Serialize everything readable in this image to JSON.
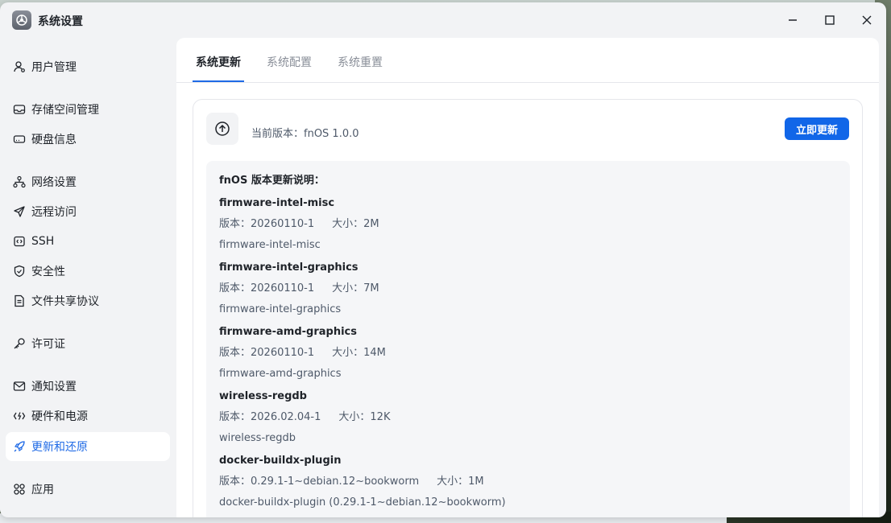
{
  "window": {
    "title": "系统设置"
  },
  "sidebar": {
    "items": [
      {
        "label": "用户管理",
        "icon": "user-icon"
      },
      {
        "label": "存储空间管理",
        "icon": "storage-icon"
      },
      {
        "label": "硬盘信息",
        "icon": "disk-icon"
      },
      {
        "label": "网络设置",
        "icon": "network-icon"
      },
      {
        "label": "远程访问",
        "icon": "send-icon"
      },
      {
        "label": "SSH",
        "icon": "code-icon"
      },
      {
        "label": "安全性",
        "icon": "shield-icon"
      },
      {
        "label": "文件共享协议",
        "icon": "file-icon"
      },
      {
        "label": "许可证",
        "icon": "key-icon"
      },
      {
        "label": "通知设置",
        "icon": "mail-icon"
      },
      {
        "label": "硬件和电源",
        "icon": "power-icon"
      },
      {
        "label": "更新和还原",
        "icon": "rocket-icon",
        "active": true
      },
      {
        "label": "应用",
        "icon": "apps-icon"
      }
    ]
  },
  "tabs": [
    {
      "label": "系统更新",
      "active": true
    },
    {
      "label": "系统配置"
    },
    {
      "label": "系统重置"
    }
  ],
  "update": {
    "current_version": "当前版本：fnOS 1.0.0",
    "button_label": "立即更新",
    "notes_title": "fnOS 版本更新说明：",
    "packages": [
      {
        "name": "firmware-intel-misc",
        "version": "版本：20260110-1",
        "size": "大小：2M",
        "desc": "firmware-intel-misc"
      },
      {
        "name": "firmware-intel-graphics",
        "version": "版本：20260110-1",
        "size": "大小：7M",
        "desc": "firmware-intel-graphics"
      },
      {
        "name": "firmware-amd-graphics",
        "version": "版本：20260110-1",
        "size": "大小：14M",
        "desc": "firmware-amd-graphics"
      },
      {
        "name": "wireless-regdb",
        "version": "版本：2026.02.04-1",
        "size": "大小：12K",
        "desc": "wireless-regdb"
      },
      {
        "name": "docker-buildx-plugin",
        "version": "版本：0.29.1-1~debian.12~bookworm",
        "size": "大小：1M",
        "desc": "docker-buildx-plugin (0.29.1-1~debian.12~bookworm)"
      }
    ]
  },
  "colors": {
    "accent": "#1166e8",
    "active_text": "#1f6ae6"
  }
}
